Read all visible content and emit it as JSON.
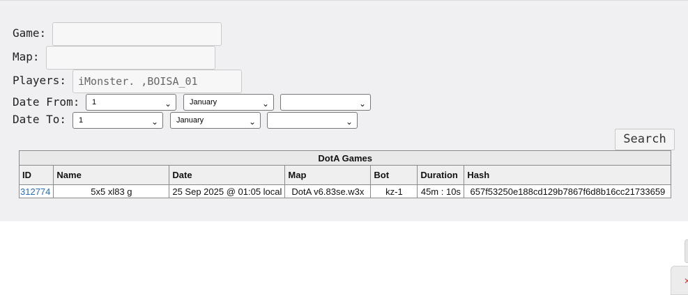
{
  "form": {
    "game_label": "Game:",
    "game_value": "",
    "map_label": "Map:",
    "map_value": "",
    "players_label": "Players:",
    "players_value": "iMonster. ,BOISA_01",
    "date_from_label": "Date From:",
    "date_from": {
      "day": "1",
      "month": "January",
      "year": ""
    },
    "date_to_label": "Date To:",
    "date_to": {
      "day": "1",
      "month": "January",
      "year": ""
    },
    "search_label": "Search"
  },
  "table": {
    "title": "DotA Games",
    "columns": [
      "ID",
      "Name",
      "Date",
      "Map",
      "Bot",
      "Duration",
      "Hash"
    ],
    "rows": [
      {
        "id": "312774",
        "name": "5x5 xl83 g",
        "date": "25 Sep 2025 @ 01:05 local",
        "map": "DotA v6.83se.w3x",
        "bot": "kz-1",
        "duration": "45m : 10s",
        "hash": "657f53250e188cd129b7867f6d8b16cc21733659"
      }
    ]
  },
  "icons": {
    "select_arrow": "chevron-down-icon",
    "side_widget": "close-icon"
  }
}
